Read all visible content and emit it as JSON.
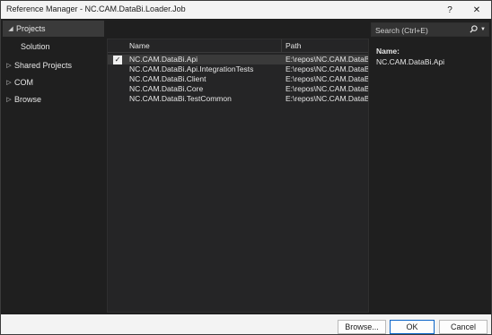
{
  "window": {
    "title": "Reference Manager - NC.CAM.DataBi.Loader.Job",
    "help_glyph": "?",
    "close_glyph": "✕"
  },
  "nav": {
    "items": [
      {
        "label": "Projects",
        "arrow": "◢",
        "selected": true
      },
      {
        "label": "Solution",
        "arrow": "",
        "selected": false
      },
      {
        "label": "Shared Projects",
        "arrow": "▷",
        "selected": false
      },
      {
        "label": "COM",
        "arrow": "▷",
        "selected": false
      },
      {
        "label": "Browse",
        "arrow": "▷",
        "selected": false
      }
    ]
  },
  "list": {
    "columns": {
      "name": "Name",
      "path": "Path"
    },
    "rows": [
      {
        "name": "NC.CAM.DataBi.Api",
        "path": "E:\\repos\\NC.CAM.DataB",
        "checked": true,
        "selected": true
      },
      {
        "name": "NC.CAM.DataBi.Api.IntegrationTests",
        "path": "E:\\repos\\NC.CAM.DataB",
        "checked": false,
        "selected": false
      },
      {
        "name": "NC.CAM.DataBi.Client",
        "path": "E:\\repos\\NC.CAM.DataB",
        "checked": false,
        "selected": false
      },
      {
        "name": "NC.CAM.DataBi.Core",
        "path": "E:\\repos\\NC.CAM.DataB",
        "checked": false,
        "selected": false
      },
      {
        "name": "NC.CAM.DataBi.TestCommon",
        "path": "E:\\repos\\NC.CAM.DataB",
        "checked": false,
        "selected": false
      }
    ]
  },
  "search": {
    "placeholder": "Search (Ctrl+E)",
    "icon": "search-icon"
  },
  "details": {
    "label": "Name:",
    "value": "NC.CAM.DataBi.Api"
  },
  "buttons": {
    "browse": "Browse...",
    "ok": "OK",
    "cancel": "Cancel"
  },
  "colors": {
    "accent": "#0a64c8",
    "background": "#1f1f1f",
    "selection": "#3a3a3a"
  }
}
